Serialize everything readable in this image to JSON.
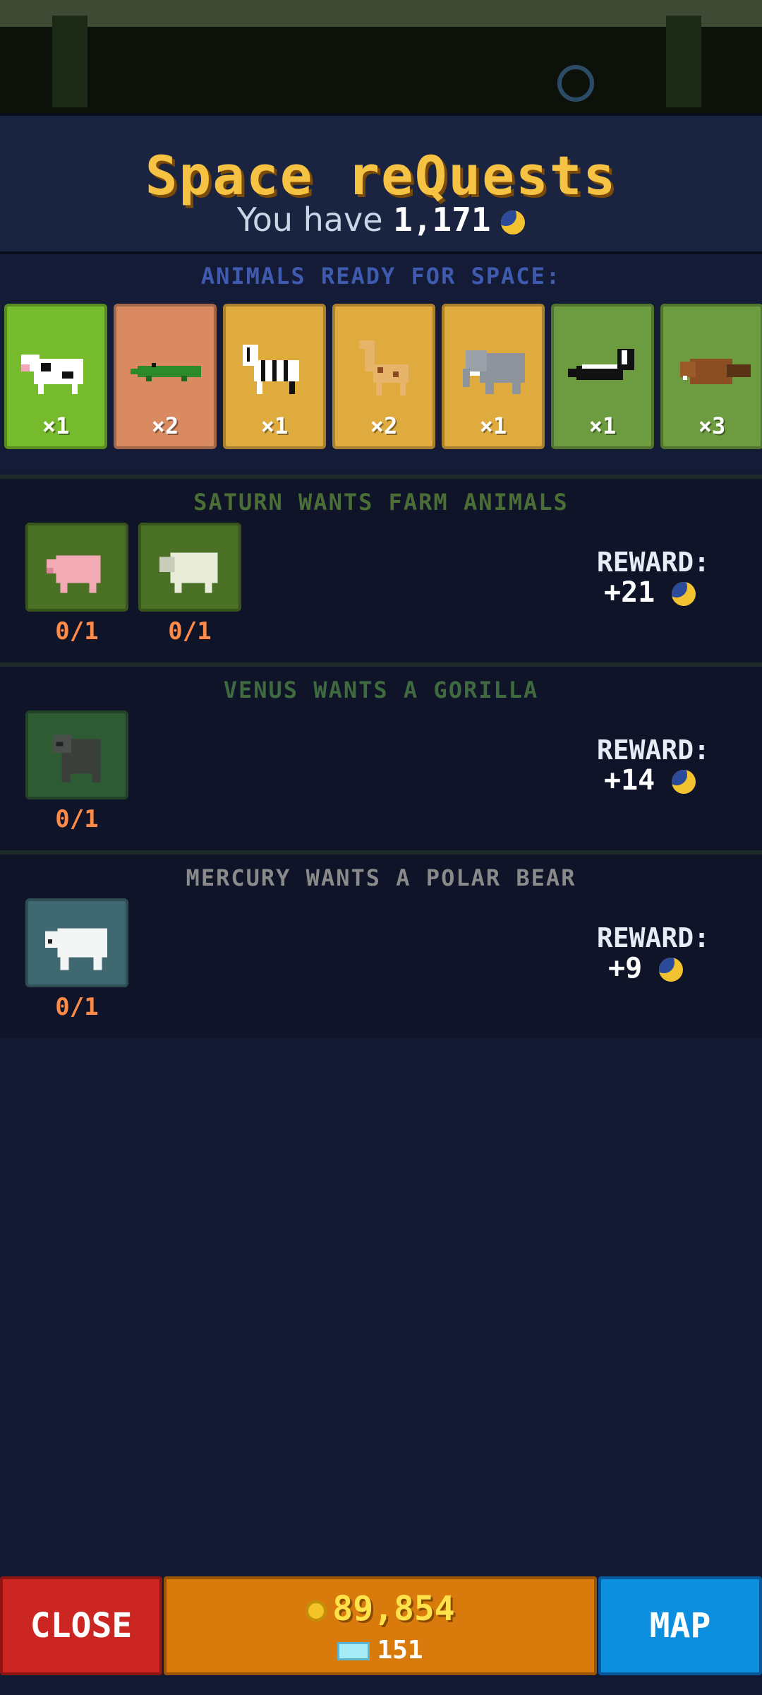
{
  "header": {
    "title": "Space reQuests",
    "balance_prefix": "You have",
    "balance_value": "1,171",
    "balance_icon": "moon-coin-icon"
  },
  "ready": {
    "title": "ANIMALS READY FOR SPACE:",
    "cards": [
      {
        "animal": "cow",
        "count": "×1",
        "bg": "#76bb2c"
      },
      {
        "animal": "crocodile",
        "count": "×2",
        "bg": "#d98a60"
      },
      {
        "animal": "zebra",
        "count": "×1",
        "bg": "#e0ab3e"
      },
      {
        "animal": "giraffe",
        "count": "×2",
        "bg": "#e0ab3e"
      },
      {
        "animal": "elephant",
        "count": "×1",
        "bg": "#e0ab3e"
      },
      {
        "animal": "skunk",
        "count": "×1",
        "bg": "#6c9c3f"
      },
      {
        "animal": "beaver",
        "count": "×3",
        "bg": "#6c9c3f"
      }
    ]
  },
  "requests": [
    {
      "title": "SATURN WANTS FARM ANIMALS",
      "title_color": "#4a6e36",
      "slots": [
        {
          "animal": "pig",
          "progress": "0/1",
          "bg": "#4a7126"
        },
        {
          "animal": "sheep",
          "progress": "0/1",
          "bg": "#4a7126"
        }
      ],
      "reward_label": "REWARD:",
      "reward_value": "+21"
    },
    {
      "title": "VENUS WANTS A GORILLA",
      "title_color": "#3f6a3f",
      "slots": [
        {
          "animal": "gorilla",
          "progress": "0/1",
          "bg": "#2e5a34"
        }
      ],
      "reward_label": "REWARD:",
      "reward_value": "+14"
    },
    {
      "title": "MERCURY WANTS A POLAR BEAR",
      "title_color": "#8a8a8a",
      "slots": [
        {
          "animal": "polar-bear",
          "progress": "0/1",
          "bg": "#3f6870"
        }
      ],
      "reward_label": "REWARD:",
      "reward_value": "+9"
    }
  ],
  "bottombar": {
    "close_label": "CLOSE",
    "coins": "89,854",
    "gems": "151",
    "map_label": "MAP"
  },
  "colors": {
    "background": "#121932",
    "title": "#f6c244",
    "close": "#cc2622",
    "currency": "#d97a0c",
    "map": "#0d8fe0"
  }
}
